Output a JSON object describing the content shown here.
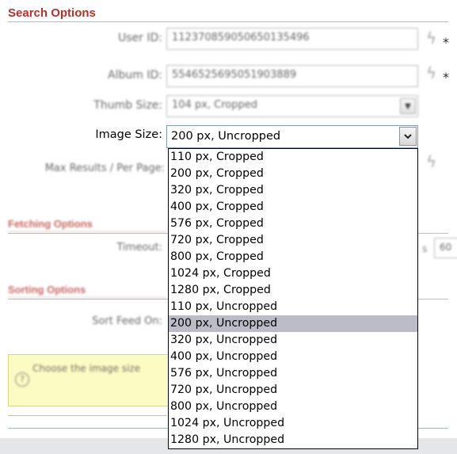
{
  "sections": {
    "search": "Search Options",
    "fetching": "Fetching Options",
    "sorting": "Sorting Options"
  },
  "fields": {
    "user_id_label": "User ID:",
    "user_id_value": "112370859050650135496",
    "album_id_label": "Album ID:",
    "album_id_value": "5546525695051903889",
    "thumb_size_label": "Thumb Size:",
    "thumb_size_value": "104 px, Cropped",
    "image_size_label": "Image Size:",
    "image_size_value": "200 px, Uncropped",
    "max_results_label": "Max Results / Per Page:",
    "timeout_label": "Timeout:",
    "timeout_value": "60",
    "sort_feed_label": "Sort Feed On:"
  },
  "required_marker": "*",
  "hint": {
    "text": "Choose the image size"
  },
  "image_size_options": [
    "110 px, Cropped",
    "200 px, Cropped",
    "320 px, Cropped",
    "400 px, Cropped",
    "576 px, Cropped",
    "720 px, Cropped",
    "800 px, Cropped",
    "1024 px, Cropped",
    "1280 px, Cropped",
    "110 px, Uncropped",
    "200 px, Uncropped",
    "320 px, Uncropped",
    "400 px, Uncropped",
    "576 px, Uncropped",
    "720 px, Uncropped",
    "800 px, Uncropped",
    "1024 px, Uncropped",
    "1280 px, Uncropped"
  ],
  "selected_option_index": 10,
  "colors": {
    "section_title": "#b3322b",
    "hint_background": "#fbfbc4",
    "selected_highlight": "#bcbcc8"
  }
}
